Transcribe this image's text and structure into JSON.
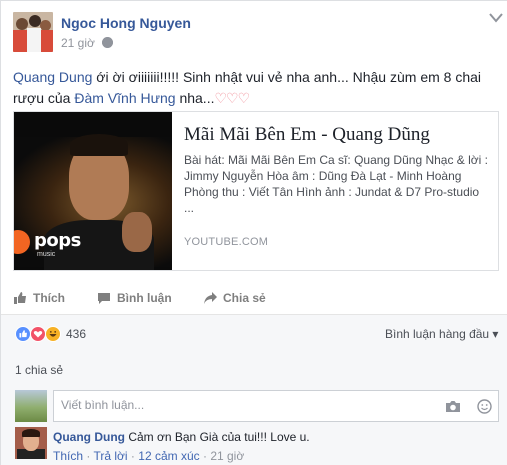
{
  "post": {
    "author": "Ngoc Hong Nguyen",
    "time": "21 giờ",
    "text_mention_1": "Quang Dung",
    "text_part_1": " ới ời ơiiiiiii!!!!! Sinh nhật vui vẻ nha anh... Nhậu zùm em 8 chai rượu của ",
    "text_mention_2": "Đàm Vĩnh Hưng",
    "text_part_2": " nha...",
    "hearts": "♡♡♡"
  },
  "link_card": {
    "title": "Mãi Mãi Bên Em - Quang Dũng",
    "description": "Bài hát: Mãi Mãi Bên Em Ca sĩ: Quang Dũng Nhạc & lời : Jimmy Nguyễn Hòa âm : Dũng Đà Lạt - Minh Hoàng Phòng thu : Viết Tân Hình ảnh : Jundat & D7 Pro-studio ...",
    "domain": "YOUTUBE.COM",
    "logo_text": "pops",
    "logo_sub": "music"
  },
  "actions": {
    "like": "Thích",
    "comment": "Bình luận",
    "share": "Chia sẻ"
  },
  "reactions": {
    "count": "436",
    "sort_label": "Bình luận hàng đầu ▾"
  },
  "shares": "1 chia sẻ",
  "comment_box": {
    "placeholder": "Viết bình luận..."
  },
  "comment": {
    "author": "Quang Dung",
    "text": " Cảm ơn Bạn Già của tui!!! Love u.",
    "like": "Thích",
    "reply": "Trả lời",
    "reactions": "12 cảm xúc",
    "time": "21 giờ"
  },
  "colors": {
    "link_blue": "#365899",
    "like_blue": "#5890ff",
    "love_red": "#f25268",
    "haha_yellow": "#f7b125"
  }
}
